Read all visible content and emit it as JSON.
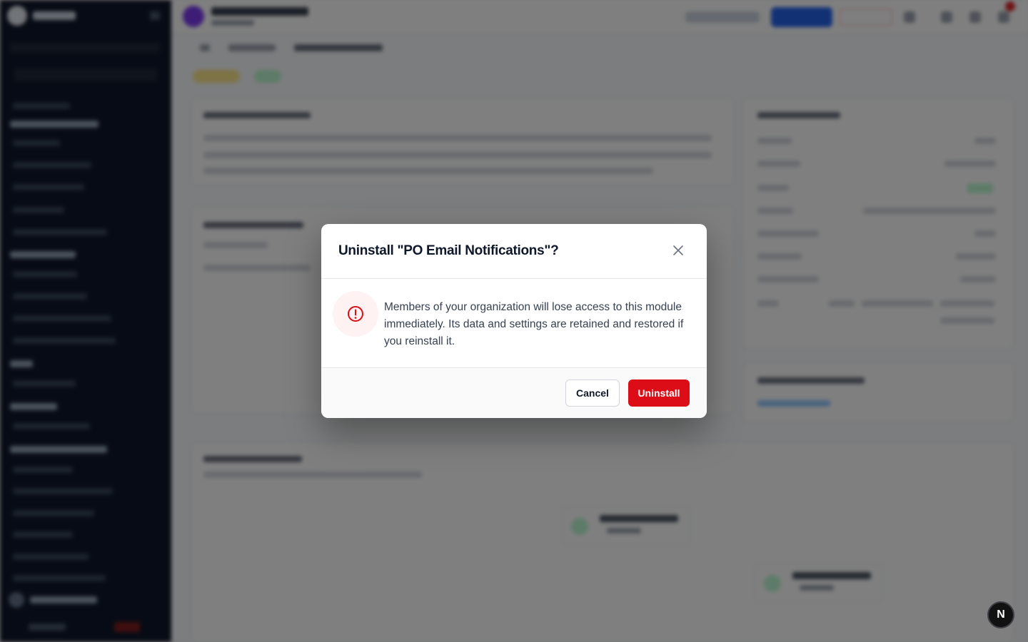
{
  "modal": {
    "title": "Uninstall \"PO Email Notifications\"?",
    "message": "Members of your organization will lose access to this module immediately. Its data and settings are retained and restored if you reinstall it.",
    "cancel_label": "Cancel",
    "confirm_label": "Uninstall",
    "close_icon": "close-icon",
    "warning_icon": "alert-circle-icon",
    "confirm_color": "#dc0d17"
  },
  "dev_badge": {
    "letter": "N",
    "icon": "nextjs-icon"
  }
}
